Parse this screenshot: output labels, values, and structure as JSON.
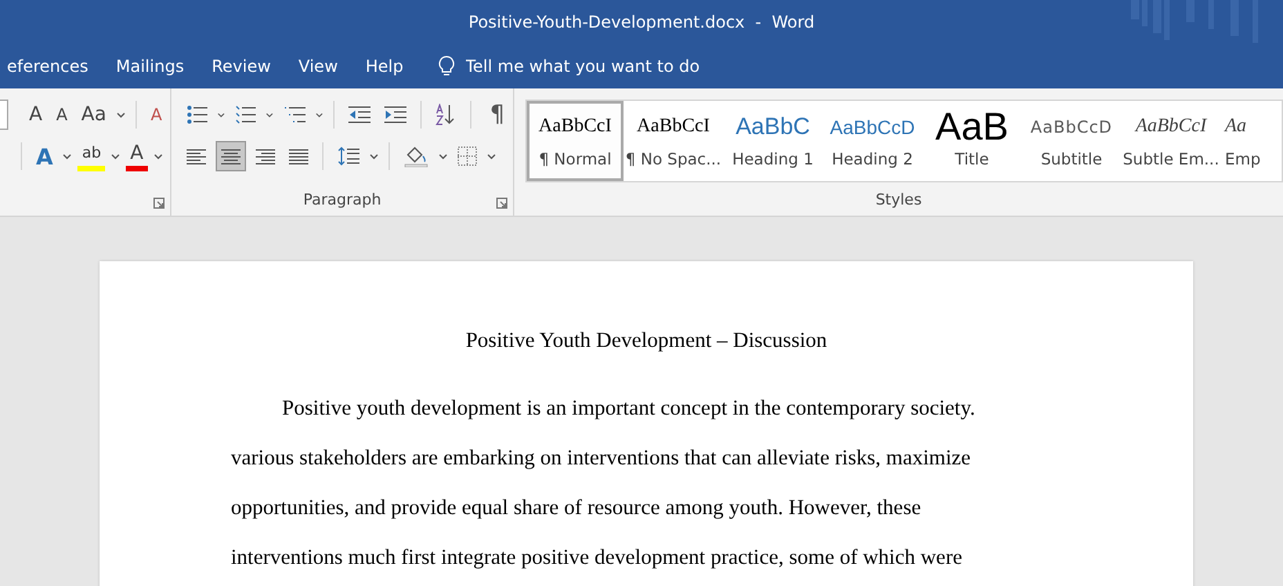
{
  "window": {
    "title": "Positive-Youth-Development.docx  -  Word"
  },
  "tabs": [
    {
      "label": "eferences"
    },
    {
      "label": "Mailings"
    },
    {
      "label": "Review"
    },
    {
      "label": "View"
    },
    {
      "label": "Help"
    }
  ],
  "tell_me": {
    "placeholder": "Tell me what you want to do"
  },
  "font_group": {
    "row_1": [
      {
        "kind": "grow",
        "label": "A"
      },
      {
        "kind": "shrink",
        "label": "A"
      },
      {
        "kind": "case",
        "label": "Aa"
      },
      {
        "kind": "clear",
        "label": "A"
      }
    ],
    "row_2": [
      {
        "kind": "effects",
        "label": "A"
      },
      {
        "kind": "highlight",
        "label": "ab"
      },
      {
        "kind": "color",
        "label": "A"
      }
    ]
  },
  "paragraph_group": {
    "label": "Paragraph",
    "pilcrow": "¶",
    "align": [
      {
        "kind": "left",
        "selected": false
      },
      {
        "kind": "center",
        "selected": true
      },
      {
        "kind": "right",
        "selected": false
      },
      {
        "kind": "justify",
        "selected": false
      }
    ]
  },
  "styles_group": {
    "label": "Styles",
    "styles": [
      {
        "preview": "AaBbCcI",
        "name": "¶ Normal",
        "kind": "serif",
        "selected": true
      },
      {
        "preview": "AaBbCcI",
        "name": "¶ No Spac...",
        "kind": "serif",
        "selected": false
      },
      {
        "preview": "AaBbC",
        "name": "Heading 1",
        "kind": "heading1",
        "selected": false
      },
      {
        "preview": "AaBbCcD",
        "name": "Heading 2",
        "kind": "heading2",
        "selected": false
      },
      {
        "preview": "AaB",
        "name": "Title",
        "kind": "title",
        "selected": false
      },
      {
        "preview": "AaBbCcD",
        "name": "Subtitle",
        "kind": "subtitle",
        "selected": false
      },
      {
        "preview": "AaBbCcI",
        "name": "Subtle Em...",
        "kind": "italic",
        "selected": false
      },
      {
        "preview": "Aa",
        "name": "Emp",
        "kind": "italic",
        "selected": false
      }
    ]
  },
  "document": {
    "title": "Positive Youth Development – Discussion",
    "paragraph_lines": [
      "Positive youth development is an important concept in the contemporary society.",
      "various stakeholders are embarking on interventions that can alleviate risks, maximize",
      "opportunities, and provide equal share of resource among youth. However, these",
      "interventions much first integrate positive development practice, some of which were"
    ]
  }
}
